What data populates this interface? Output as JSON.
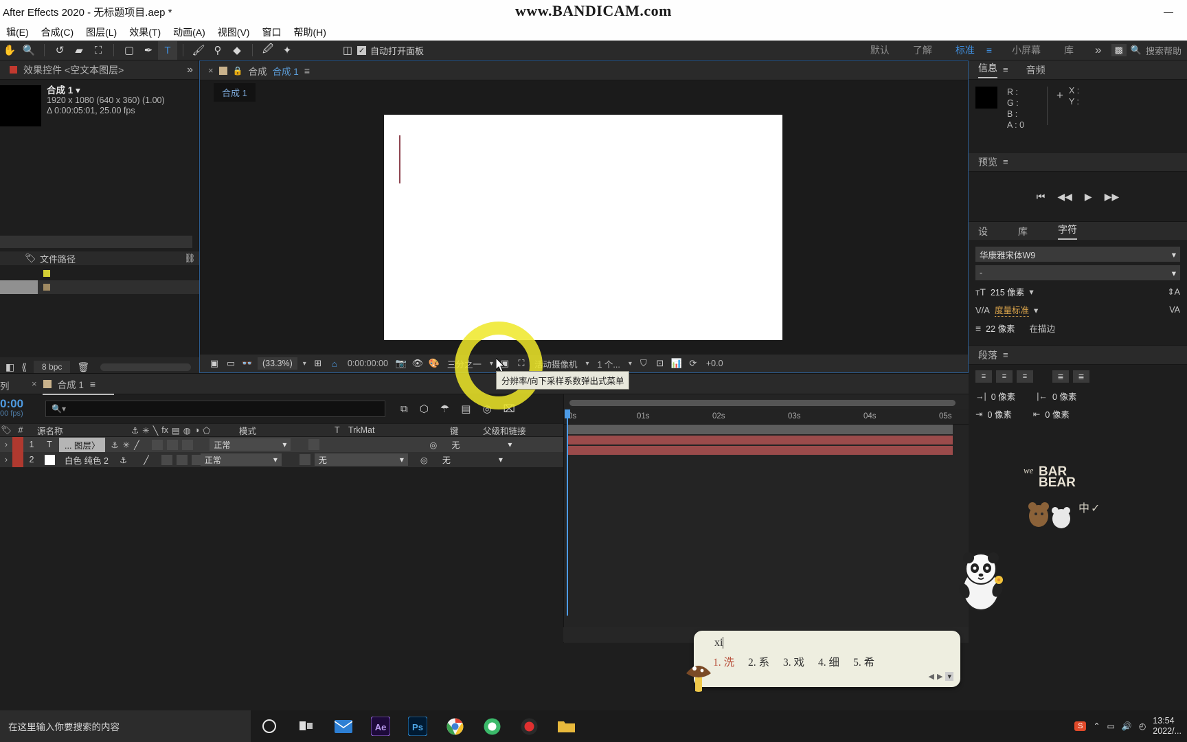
{
  "titlebar": {
    "title": "After Effects 2020 - 无标题项目.aep *",
    "watermark": "www.BANDICAM.com",
    "minimize": "—",
    "maximize": "▢",
    "close": "✕"
  },
  "menubar": {
    "items": [
      "辑(E)",
      "合成(C)",
      "图层(L)",
      "效果(T)",
      "动画(A)",
      "视图(V)",
      "窗口",
      "帮助(H)"
    ]
  },
  "toolbar": {
    "tools": [
      {
        "name": "hand-tool",
        "glyph": "✋"
      },
      {
        "name": "zoom-tool",
        "glyph": "🔍"
      },
      {
        "name": "rotate-tool",
        "glyph": "↺"
      },
      {
        "name": "camera-tool",
        "glyph": "🎥"
      },
      {
        "name": "anchor-point-tool",
        "glyph": "⛶"
      },
      {
        "name": "shape-tool",
        "glyph": "▢"
      },
      {
        "name": "pen-tool",
        "glyph": "✒"
      },
      {
        "name": "type-tool",
        "glyph": "T"
      },
      {
        "name": "brush-tool",
        "glyph": "🖌"
      },
      {
        "name": "clone-stamp-tool",
        "glyph": "⚱"
      },
      {
        "name": "eraser-tool",
        "glyph": "◆"
      },
      {
        "name": "roto-brush-tool",
        "glyph": "🖋"
      },
      {
        "name": "puppet-pin-tool",
        "glyph": "✦"
      }
    ],
    "active_tool_index": 7,
    "snapping_icon": "◫",
    "auto_open_panel_label": "自动打开面板",
    "auto_open_checked": true,
    "workspaces": [
      "默认",
      "了解",
      "标准",
      "小屏幕",
      "库"
    ],
    "workspace_selected": "标准",
    "workspace_more": "»",
    "search_placeholder": "搜索帮助"
  },
  "effect_controls": {
    "tab_label": "效果控件 <空文本图层>",
    "comp_name": "合成 1",
    "dimensions": "1920 x 1080  (640 x 360) (1.00)",
    "duration": "Δ 0:00:05:01, 25.00 fps",
    "file_path_label": "文件路径",
    "bpc": "8 bpc"
  },
  "viewer": {
    "tab_name_prefix": "合成",
    "tab_name": "合成 1",
    "sub_tab": "合成 1",
    "toolbar": {
      "zoom": "(33.3%)",
      "timecode": "0:00:00:00",
      "resolution": "三分之一",
      "camera": "活动摄像机",
      "views": "1 个...",
      "exposure": "+0.0"
    },
    "tooltip": "分辨率/向下采样系数弹出式菜单"
  },
  "timeline": {
    "left_label": "列",
    "tab_label": "合成 1",
    "current_time": "0:00",
    "current_fps": "00 fps)",
    "search_placeholder": "",
    "headers": [
      "#",
      "源名称",
      "模式",
      "T",
      "TrkMat",
      "键",
      "父级和链接"
    ],
    "layers": [
      {
        "index": "1",
        "type_icon": "T",
        "name": "... 图层〉",
        "mode": "正常",
        "trkmat": "",
        "parent": "无",
        "selected": true
      },
      {
        "index": "2",
        "type_icon": "",
        "name": "白色 纯色 2",
        "mode": "正常",
        "trkmat": "无",
        "parent": "无",
        "selected": false
      }
    ],
    "ruler_ticks": [
      "0s",
      "01s",
      "02s",
      "03s",
      "04s",
      "05s"
    ]
  },
  "right_panels": {
    "info": {
      "tabs": [
        "信息",
        "音频"
      ],
      "active_tab": "信息",
      "r_label": "R :",
      "g_label": "G :",
      "b_label": "B :",
      "a_label": "A : 0",
      "x_label": "X :",
      "y_label": "Y :"
    },
    "preview": {
      "title": "预览",
      "buttons": [
        "⏮",
        "◀◀",
        "▶",
        "▶▶"
      ]
    },
    "character": {
      "tabs": [
        "设",
        "库",
        "字符"
      ],
      "active_tab": "字符",
      "font_family": "华康雅宋体W9",
      "font_style": "-",
      "font_size": "215 像素",
      "leading_label": "度量标准",
      "tracking": "22 像素",
      "stroke_label": "在描边"
    },
    "paragraph": {
      "title": "段落",
      "indent_left": "0 像素",
      "indent_right": "0 像素",
      "space_before": "0 像素",
      "space_after": "0 像素"
    }
  },
  "ime": {
    "input": "xi",
    "candidates": [
      {
        "num": "1.",
        "word": "洗"
      },
      {
        "num": "2.",
        "word": "系"
      },
      {
        "num": "3.",
        "word": "戏"
      },
      {
        "num": "4.",
        "word": "细"
      },
      {
        "num": "5.",
        "word": "希"
      }
    ],
    "prev": "◀",
    "next": "▶"
  },
  "taskbar": {
    "search_placeholder": "在这里输入你要搜索的内容",
    "apps": [
      "cortana-icon",
      "task-view-icon",
      "mail-icon",
      "after-effects-icon",
      "photoshop-icon",
      "chrome-icon",
      "browser-icon",
      "record-icon",
      "folder-icon"
    ],
    "time": "13:54",
    "date": "2022/..."
  }
}
